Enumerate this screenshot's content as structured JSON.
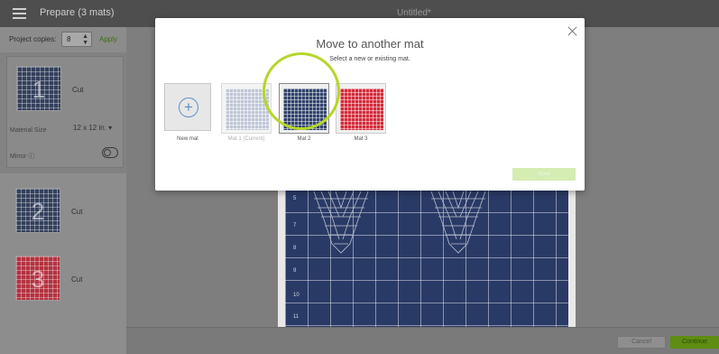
{
  "app": {
    "top_title": "Prepare (3 mats)",
    "document_title": "Untitled*"
  },
  "left_panel": {
    "copies_label": "Project copies:",
    "copies_value": "8",
    "apply_label": "Apply",
    "mats": [
      {
        "number": "1",
        "label": "Cut",
        "color": "#34405c"
      },
      {
        "number": "2",
        "label": "Cut",
        "color": "#34405c"
      },
      {
        "number": "3",
        "label": "Cut",
        "color": "#b33340"
      }
    ],
    "material_size_label": "Material Size",
    "material_size_value": "12 x 12 in.",
    "material_size_caret": "▾",
    "mirror_label": "Mirror ⓘ"
  },
  "canvas": {
    "ruler_marks": [
      "5",
      "7",
      "8",
      "9",
      "10",
      "11"
    ]
  },
  "bottom": {
    "cancel_label": "Cancel",
    "continue_label": "Continue"
  },
  "modal": {
    "title": "Move to another mat",
    "subtitle": "Select a new or existing mat.",
    "options": [
      {
        "label": "New mat",
        "icon": "plus-icon"
      },
      {
        "label": "Mat 1 (Current)",
        "state": "current"
      },
      {
        "label": "Mat 2",
        "state": "selected"
      },
      {
        "label": "Mat 3",
        "state": "default"
      }
    ],
    "move_label": "Move"
  },
  "colors": {
    "accent_green": "#5d8d12",
    "highlight_ring": "#b5d62a",
    "mat_blue": "#31436a",
    "mat_red": "#d42b3a"
  }
}
